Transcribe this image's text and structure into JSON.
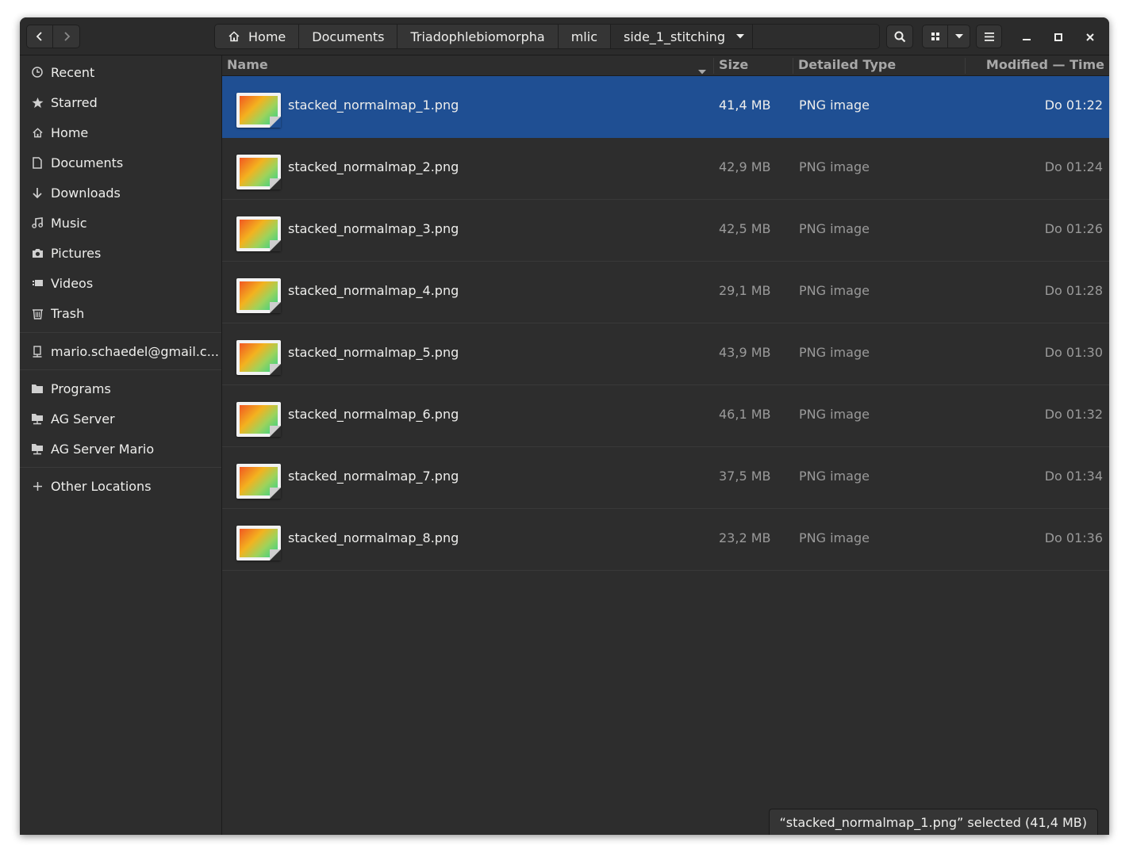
{
  "window": {
    "title": "side_1_stitching"
  },
  "nav": {
    "back_icon": "chevron-left-icon",
    "forward_icon": "chevron-right-icon"
  },
  "breadcrumbs": [
    {
      "label": "Home",
      "icon": "home-icon"
    },
    {
      "label": "Documents"
    },
    {
      "label": "Triadophlebiomorpha"
    },
    {
      "label": "mlic"
    },
    {
      "label": "side_1_stitching",
      "icon": "chevron-down-icon"
    }
  ],
  "toolbar": {
    "search_icon": "search-icon",
    "view_icon": "grid-view-icon",
    "view_options_icon": "chevron-down-icon",
    "menu_icon": "hamburger-menu-icon",
    "minimize_icon": "minimize-icon",
    "maximize_icon": "maximize-icon",
    "close_icon": "close-icon"
  },
  "sidebar": {
    "places": [
      {
        "label": "Recent",
        "icon": "clock-icon"
      },
      {
        "label": "Starred",
        "icon": "star-icon"
      },
      {
        "label": "Home",
        "icon": "home-icon"
      },
      {
        "label": "Documents",
        "icon": "document-icon"
      },
      {
        "label": "Downloads",
        "icon": "download-icon"
      },
      {
        "label": "Music",
        "icon": "music-icon"
      },
      {
        "label": "Pictures",
        "icon": "camera-icon"
      },
      {
        "label": "Videos",
        "icon": "video-icon"
      },
      {
        "label": "Trash",
        "icon": "trash-icon"
      }
    ],
    "accounts": [
      {
        "label": "mario.schaedel@gmail.c...",
        "icon": "online-account-icon"
      }
    ],
    "bookmarks": [
      {
        "label": "Programs",
        "icon": "folder-icon"
      },
      {
        "label": "AG Server",
        "icon": "network-folder-icon"
      },
      {
        "label": "AG Server Mario",
        "icon": "network-folder-icon"
      }
    ],
    "other": {
      "label": "Other Locations",
      "icon": "plus-icon"
    }
  },
  "columns": {
    "name": "Name",
    "size": "Size",
    "type": "Detailed Type",
    "modified": "Modified — Time",
    "sort_icon": "sort-down-icon"
  },
  "files": [
    {
      "name": "stacked_normalmap_1.png",
      "size": "41,4 MB",
      "type": "PNG image",
      "modified": "Do 01:22",
      "selected": true
    },
    {
      "name": "stacked_normalmap_2.png",
      "size": "42,9 MB",
      "type": "PNG image",
      "modified": "Do 01:24",
      "selected": false
    },
    {
      "name": "stacked_normalmap_3.png",
      "size": "42,5 MB",
      "type": "PNG image",
      "modified": "Do 01:26",
      "selected": false
    },
    {
      "name": "stacked_normalmap_4.png",
      "size": "29,1 MB",
      "type": "PNG image",
      "modified": "Do 01:28",
      "selected": false
    },
    {
      "name": "stacked_normalmap_5.png",
      "size": "43,9 MB",
      "type": "PNG image",
      "modified": "Do 01:30",
      "selected": false
    },
    {
      "name": "stacked_normalmap_6.png",
      "size": "46,1 MB",
      "type": "PNG image",
      "modified": "Do 01:32",
      "selected": false
    },
    {
      "name": "stacked_normalmap_7.png",
      "size": "37,5 MB",
      "type": "PNG image",
      "modified": "Do 01:34",
      "selected": false
    },
    {
      "name": "stacked_normalmap_8.png",
      "size": "23,2 MB",
      "type": "PNG image",
      "modified": "Do 01:36",
      "selected": false
    }
  ],
  "status": {
    "text": "“stacked_normalmap_1.png” selected  (41,4 MB)"
  },
  "colors": {
    "selection": "#1f4f93",
    "background": "#2d2d2d",
    "text": "#eeeeec",
    "dim_text": "#9a9a9a"
  }
}
